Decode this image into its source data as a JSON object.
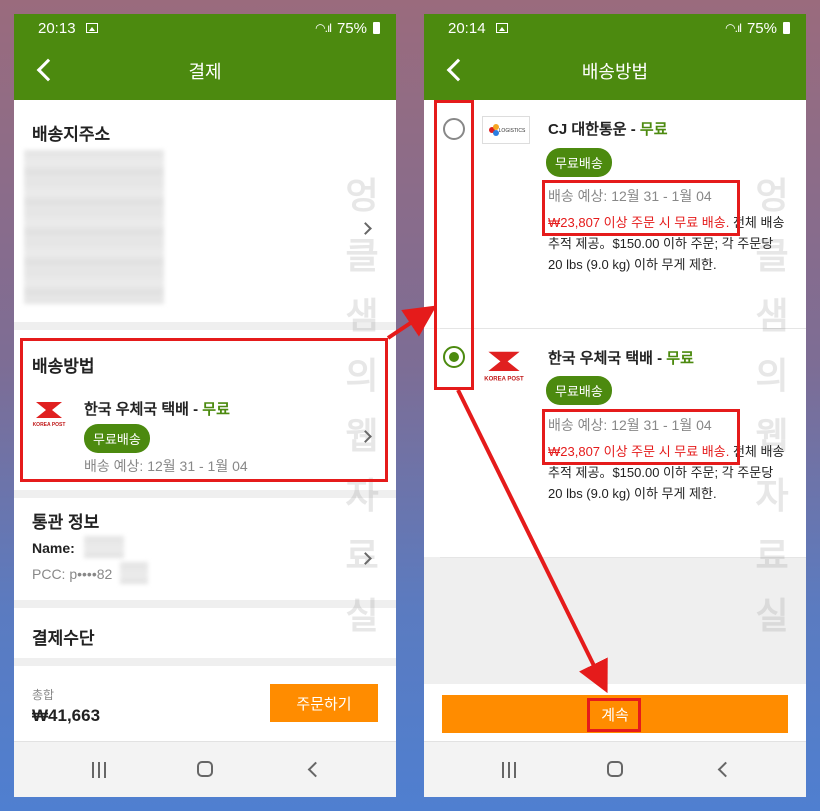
{
  "left_screen": {
    "status_time": "20:13",
    "status_battery": "75%",
    "title": "결제",
    "address_section_title": "배송지주소",
    "shipping_section_title": "배송방법",
    "shipping_carrier": "한국 우체국 택배",
    "shipping_dash": " - ",
    "shipping_price": "무료",
    "free_badge": "무료배송",
    "shipping_eta": "배송 예상: 12월 31 - 1월 04",
    "customs_title": "통관 정보",
    "customs_name_label": "Name:",
    "customs_pcc": "PCC: p••••82",
    "payment_title": "결제수단",
    "total_label": "총합",
    "total_value": "₩41,663",
    "order_button": "주문하기"
  },
  "right_screen": {
    "status_time": "20:14",
    "status_battery": "75%",
    "title": "배송방법",
    "options": [
      {
        "carrier": "CJ 대한통운",
        "dash": " - ",
        "price": "무료",
        "badge": "무료배송",
        "eta": "배송 예상: 12월 31 - 1월 04",
        "free_threshold": "₩23,807 이상 주문 시 무료 배송.",
        "desc_rest": " 전체 배송 추적 제공。$150.00 이하 주문; 각 주문당 20 lbs (9.0 kg) 이하 무게 제한."
      },
      {
        "carrier": "한국 우체국 택배",
        "dash": " - ",
        "price": "무료",
        "badge": "무료배송",
        "eta": "배송 예상: 12월 31 - 1월 04",
        "free_threshold": "₩23,807 이상 주문 시 무료 배송.",
        "desc_rest": " 전체 배송 추적 제공。$150.00 이하 주문; 각 주문당 20 lbs (9.0 kg) 이하 무게 제한."
      }
    ],
    "continue_button": "계속",
    "cj_logo_text": "LOGISTICS"
  },
  "logo_korea_post": "KOREA POST",
  "watermark_chars": [
    "엉",
    "클",
    "샘",
    "의",
    "웹",
    "자",
    "료",
    "실"
  ],
  "colors": {
    "brand_green": "#4c8a0f",
    "accent_orange": "#ff8c00",
    "annotation_red": "#e51b1b"
  }
}
